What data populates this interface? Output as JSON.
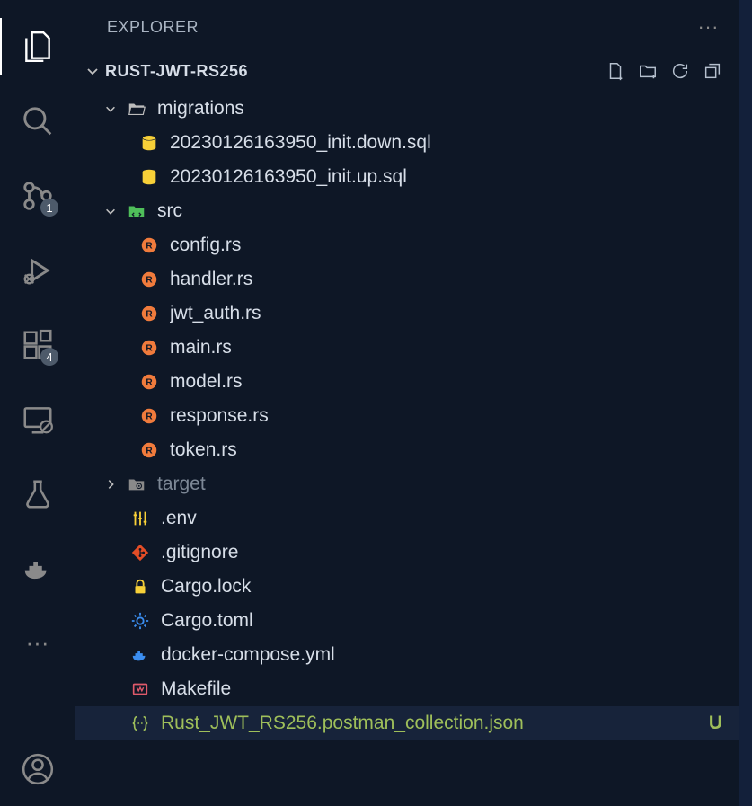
{
  "explorer": {
    "title": "EXPLORER",
    "project": "RUST-JWT-RS256"
  },
  "activity": {
    "scm_badge": "1",
    "ext_badge": "4"
  },
  "tree": {
    "migrations": {
      "name": "migrations",
      "files": [
        "20230126163950_init.down.sql",
        "20230126163950_init.up.sql"
      ]
    },
    "src": {
      "name": "src",
      "files": [
        "config.rs",
        "handler.rs",
        "jwt_auth.rs",
        "main.rs",
        "model.rs",
        "response.rs",
        "token.rs"
      ]
    },
    "target": {
      "name": "target"
    },
    "rootFiles": {
      "env": ".env",
      "gitignore": ".gitignore",
      "cargolock": "Cargo.lock",
      "cargotoml": "Cargo.toml",
      "docker": "docker-compose.yml",
      "makefile": "Makefile",
      "postman": "Rust_JWT_RS256.postman_collection.json"
    },
    "postman_status": "U"
  }
}
